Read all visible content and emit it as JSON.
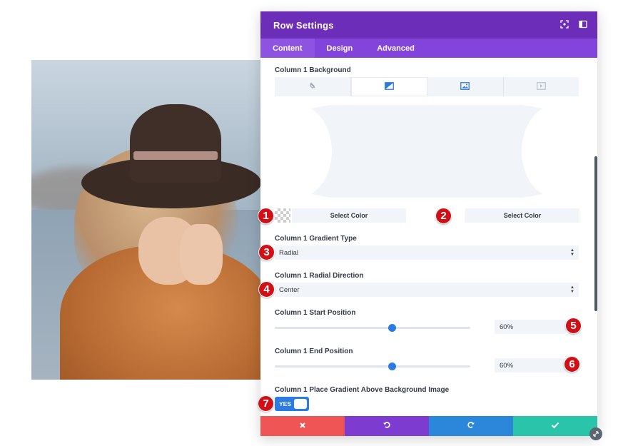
{
  "header": {
    "title": "Row Settings",
    "icons": [
      "focus-icon",
      "sidebar-toggle-icon"
    ]
  },
  "tabs": [
    {
      "label": "Content",
      "active": true
    },
    {
      "label": "Design",
      "active": false
    },
    {
      "label": "Advanced",
      "active": false
    }
  ],
  "background": {
    "label": "Column 1 Background",
    "type_tabs": [
      "no-background-icon",
      "gradient-icon",
      "image-icon",
      "video-icon"
    ],
    "active_type": "gradient",
    "color_buttons": [
      "Select Color",
      "Select Color"
    ]
  },
  "gradient_type": {
    "label": "Column 1 Gradient Type",
    "value": "Radial"
  },
  "radial_direction": {
    "label": "Column 1 Radial Direction",
    "value": "Center"
  },
  "start_position": {
    "label": "Column 1 Start Position",
    "value": "60%",
    "fraction": 0.6
  },
  "end_position": {
    "label": "Column 1 End Position",
    "value": "60%",
    "fraction": 0.6
  },
  "place_above": {
    "label": "Column 1 Place Gradient Above Background Image",
    "toggle": "YES",
    "on": true
  },
  "footer": {
    "buttons": [
      "discard-icon",
      "undo-icon",
      "redo-icon",
      "save-icon"
    ]
  },
  "markers": [
    "1",
    "2",
    "3",
    "4",
    "5",
    "6",
    "7"
  ],
  "colors": {
    "header": "#6c2eb9",
    "tabs": "#8344dc",
    "accent": "#2c7be5",
    "marker": "#d10f17",
    "discard": "#ef5555",
    "undo": "#7e3bd0",
    "redo": "#2b87da",
    "save": "#29c4a9"
  }
}
